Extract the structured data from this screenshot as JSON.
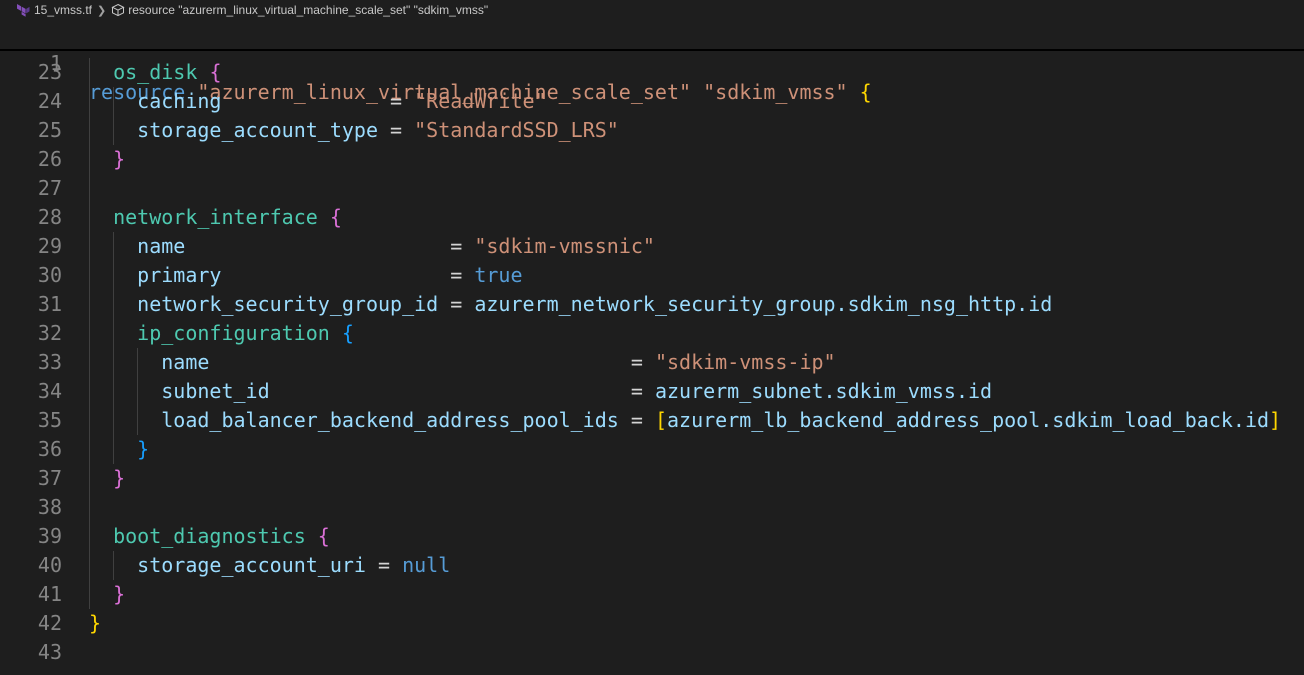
{
  "breadcrumb": {
    "file": "15_vmss.tf",
    "symbol": "resource \"azurerm_linux_virtual_machine_scale_set\" \"sdkim_vmss\""
  },
  "sticky": {
    "line_no": "1",
    "keyword": "resource",
    "type": "\"azurerm_linux_virtual_machine_scale_set\"",
    "name": "\"sdkim_vmss\"",
    "brace": "{"
  },
  "lines": [
    {
      "n": "23",
      "guides": 1,
      "tokens": [
        {
          "t": "  ",
          "c": "op"
        },
        {
          "t": "os_disk",
          "c": "blk"
        },
        {
          "t": " ",
          "c": "op"
        },
        {
          "t": "{",
          "c": "b2"
        }
      ]
    },
    {
      "n": "24",
      "guides": 2,
      "tokens": [
        {
          "t": "    ",
          "c": "op"
        },
        {
          "t": "caching",
          "c": "attr"
        },
        {
          "t": "              = ",
          "c": "op"
        },
        {
          "t": "\"ReadWrite\"",
          "c": "str"
        }
      ]
    },
    {
      "n": "25",
      "guides": 2,
      "tokens": [
        {
          "t": "    ",
          "c": "op"
        },
        {
          "t": "storage_account_type",
          "c": "attr"
        },
        {
          "t": " = ",
          "c": "op"
        },
        {
          "t": "\"StandardSSD_LRS\"",
          "c": "str"
        }
      ]
    },
    {
      "n": "26",
      "guides": 1,
      "tokens": [
        {
          "t": "  ",
          "c": "op"
        },
        {
          "t": "}",
          "c": "b2"
        }
      ]
    },
    {
      "n": "27",
      "guides": 1,
      "tokens": []
    },
    {
      "n": "28",
      "guides": 1,
      "tokens": [
        {
          "t": "  ",
          "c": "op"
        },
        {
          "t": "network_interface",
          "c": "blk"
        },
        {
          "t": " ",
          "c": "op"
        },
        {
          "t": "{",
          "c": "b2"
        }
      ]
    },
    {
      "n": "29",
      "guides": 2,
      "tokens": [
        {
          "t": "    ",
          "c": "op"
        },
        {
          "t": "name",
          "c": "attr"
        },
        {
          "t": "                      = ",
          "c": "op"
        },
        {
          "t": "\"sdkim-vmssnic\"",
          "c": "str"
        }
      ]
    },
    {
      "n": "30",
      "guides": 2,
      "tokens": [
        {
          "t": "    ",
          "c": "op"
        },
        {
          "t": "primary",
          "c": "attr"
        },
        {
          "t": "                   = ",
          "c": "op"
        },
        {
          "t": "true",
          "c": "kw"
        }
      ]
    },
    {
      "n": "31",
      "guides": 2,
      "tokens": [
        {
          "t": "    ",
          "c": "op"
        },
        {
          "t": "network_security_group_id",
          "c": "attr"
        },
        {
          "t": " = ",
          "c": "op"
        },
        {
          "t": "azurerm_network_security_group.sdkim_nsg_http.id",
          "c": "ref"
        }
      ]
    },
    {
      "n": "32",
      "guides": 2,
      "tokens": [
        {
          "t": "    ",
          "c": "op"
        },
        {
          "t": "ip_configuration",
          "c": "blk"
        },
        {
          "t": " ",
          "c": "op"
        },
        {
          "t": "{",
          "c": "b3"
        }
      ]
    },
    {
      "n": "33",
      "guides": 3,
      "tokens": [
        {
          "t": "      ",
          "c": "op"
        },
        {
          "t": "name",
          "c": "attr"
        },
        {
          "t": "                                   = ",
          "c": "op"
        },
        {
          "t": "\"sdkim-vmss-ip\"",
          "c": "str"
        }
      ]
    },
    {
      "n": "34",
      "guides": 3,
      "tokens": [
        {
          "t": "      ",
          "c": "op"
        },
        {
          "t": "subnet_id",
          "c": "attr"
        },
        {
          "t": "                              = ",
          "c": "op"
        },
        {
          "t": "azurerm_subnet.sdkim_vmss.id",
          "c": "ref"
        }
      ]
    },
    {
      "n": "35",
      "guides": 3,
      "tokens": [
        {
          "t": "      ",
          "c": "op"
        },
        {
          "t": "load_balancer_backend_address_pool_ids",
          "c": "attr"
        },
        {
          "t": " = ",
          "c": "op"
        },
        {
          "t": "[",
          "c": "b1"
        },
        {
          "t": "azurerm_lb_backend_address_pool.sdkim_load_back.id",
          "c": "ref"
        },
        {
          "t": "]",
          "c": "b1"
        }
      ]
    },
    {
      "n": "36",
      "guides": 2,
      "tokens": [
        {
          "t": "    ",
          "c": "op"
        },
        {
          "t": "}",
          "c": "b3"
        }
      ]
    },
    {
      "n": "37",
      "guides": 1,
      "tokens": [
        {
          "t": "  ",
          "c": "op"
        },
        {
          "t": "}",
          "c": "b2"
        }
      ]
    },
    {
      "n": "38",
      "guides": 1,
      "tokens": []
    },
    {
      "n": "39",
      "guides": 1,
      "tokens": [
        {
          "t": "  ",
          "c": "op"
        },
        {
          "t": "boot_diagnostics",
          "c": "blk"
        },
        {
          "t": " ",
          "c": "op"
        },
        {
          "t": "{",
          "c": "b2"
        }
      ]
    },
    {
      "n": "40",
      "guides": 2,
      "tokens": [
        {
          "t": "    ",
          "c": "op"
        },
        {
          "t": "storage_account_uri",
          "c": "attr"
        },
        {
          "t": " = ",
          "c": "op"
        },
        {
          "t": "null",
          "c": "kw"
        }
      ]
    },
    {
      "n": "41",
      "guides": 1,
      "tokens": [
        {
          "t": "  ",
          "c": "op"
        },
        {
          "t": "}",
          "c": "b2"
        }
      ]
    },
    {
      "n": "42",
      "guides": 0,
      "tokens": [
        {
          "t": "}",
          "c": "b1"
        }
      ]
    },
    {
      "n": "43",
      "guides": 0,
      "tokens": []
    }
  ]
}
